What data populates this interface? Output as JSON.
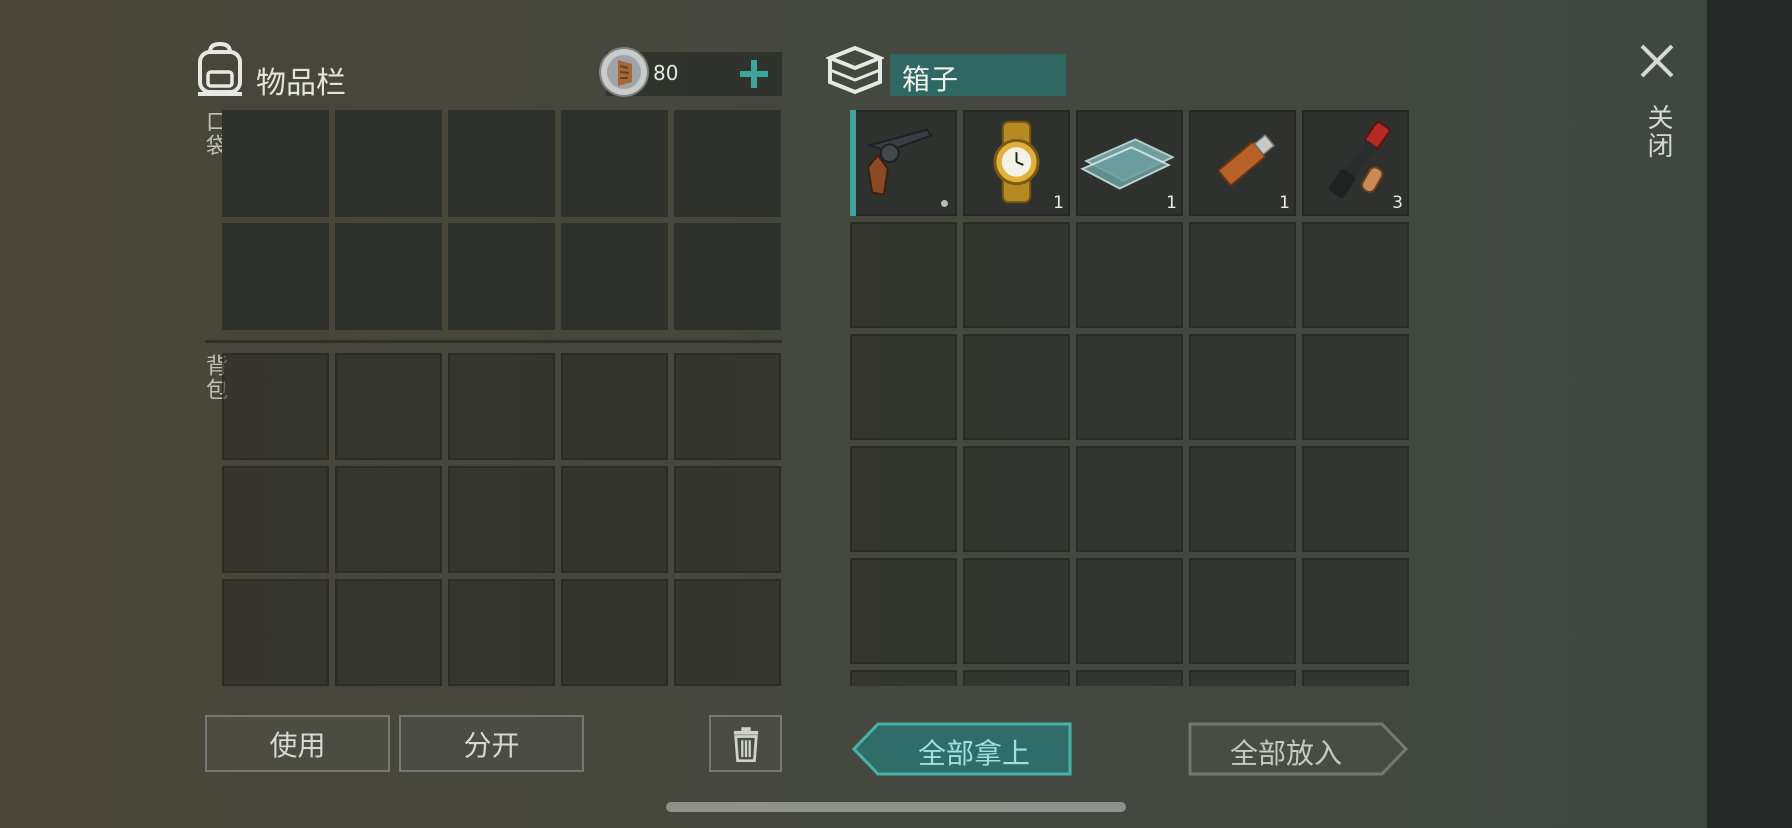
{
  "inventory": {
    "title": "物品栏",
    "icon": "backpack-icon",
    "coins": "80",
    "coin_icon": "coin-icon",
    "add_icon": "plus-icon",
    "pocket_label": "口袋",
    "backpack_label": "背包",
    "pocket_slots": 10,
    "backpack_slots": 15
  },
  "box": {
    "title": "箱子",
    "icon": "box-icon",
    "items": [
      {
        "icon": "revolver-icon",
        "qty": "",
        "selected": true
      },
      {
        "icon": "gold-watch-icon",
        "qty": "1"
      },
      {
        "icon": "glass-sheets-icon",
        "qty": "1"
      },
      {
        "icon": "usb-drive-icon",
        "qty": "1"
      },
      {
        "icon": "flare-gun-icon",
        "qty": "3"
      }
    ]
  },
  "close": {
    "label": "关闭",
    "icon": "close-icon"
  },
  "buttons": {
    "use": "使用",
    "split": "分开",
    "trash_icon": "trash-icon",
    "take_all": "全部拿上",
    "put_all": "全部放入"
  },
  "colors": {
    "accent": "#3fa49c",
    "header_field": "#2f6763",
    "take_all_bg": "#2f6e68"
  }
}
